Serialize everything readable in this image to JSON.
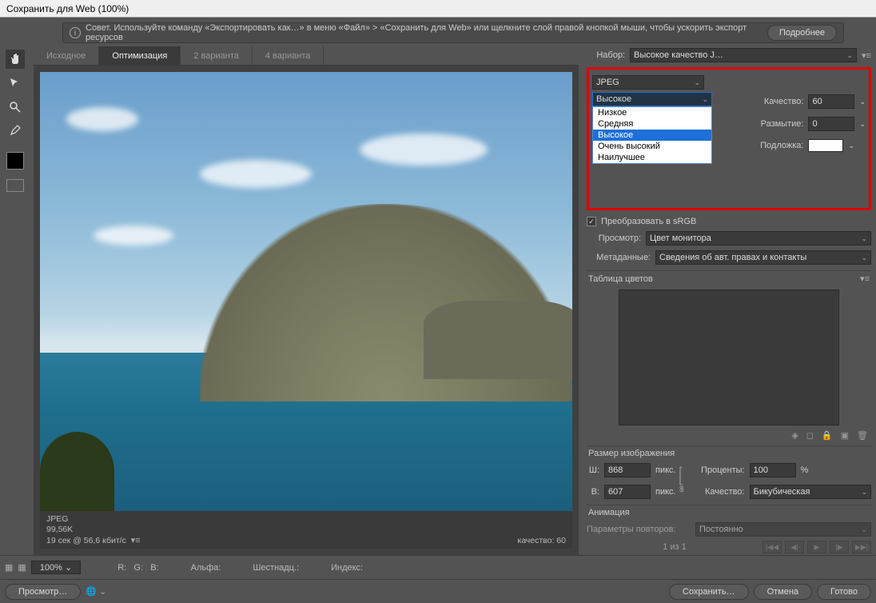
{
  "title": "Сохранить для Web (100%)",
  "tip": {
    "text": "Совет. Используйте команду «Экспортировать как…» в меню «Файл» > «Сохранить для Web» или щелкните слой правой кнопкой мыши, чтобы ускорить экспорт ресурсов",
    "more": "Подробнее"
  },
  "tabs": [
    "Исходное",
    "Оптимизация",
    "2 варианта",
    "4 варианта"
  ],
  "active_tab": 1,
  "preset": {
    "label": "Набор:",
    "value": "Высокое качество J…"
  },
  "format": {
    "value": "JPEG"
  },
  "quality_level": {
    "value": "Высокое",
    "options": [
      "Низкое",
      "Средняя",
      "Высокое",
      "Очень высокий",
      "Наилучшее"
    ]
  },
  "quality": {
    "label": "Качество:",
    "value": "60"
  },
  "blur": {
    "label": "Размытие:",
    "value": "0"
  },
  "matte": {
    "label": "Подложка:"
  },
  "srgb": {
    "label": "Преобразовать в sRGB",
    "checked": true
  },
  "preview": {
    "label": "Просмотр:",
    "value": "Цвет монитора"
  },
  "metadata": {
    "label": "Метаданные:",
    "value": "Сведения об авт. правах и контакты"
  },
  "color_table": {
    "label": "Таблица цветов"
  },
  "image_size": {
    "label": "Размер изображения",
    "w_label": "Ш:",
    "w": "868",
    "w_unit": "пикс.",
    "h_label": "В:",
    "h": "607",
    "h_unit": "пикс.",
    "pct_label": "Проценты:",
    "pct": "100",
    "pct_unit": "%",
    "qual_label": "Качество:",
    "qual": "Бикубическая"
  },
  "animation": {
    "label": "Анимация",
    "loop_label": "Параметры повторов:",
    "loop_value": "Постоянно",
    "frame": "1 из 1"
  },
  "canvas_meta": {
    "format": "JPEG",
    "size": "99,56K",
    "time": "19 сек @ 56,6 кбит/с",
    "quality": "качество: 60"
  },
  "footer": {
    "zoom": "100%",
    "r": "R:",
    "g": "G:",
    "b": "B:",
    "alpha": "Альфа:",
    "hex": "Шестнадц.:",
    "index": "Индекс:",
    "preview_btn": "Просмотр…",
    "save": "Сохранить…",
    "cancel": "Отмена",
    "done": "Готово"
  }
}
